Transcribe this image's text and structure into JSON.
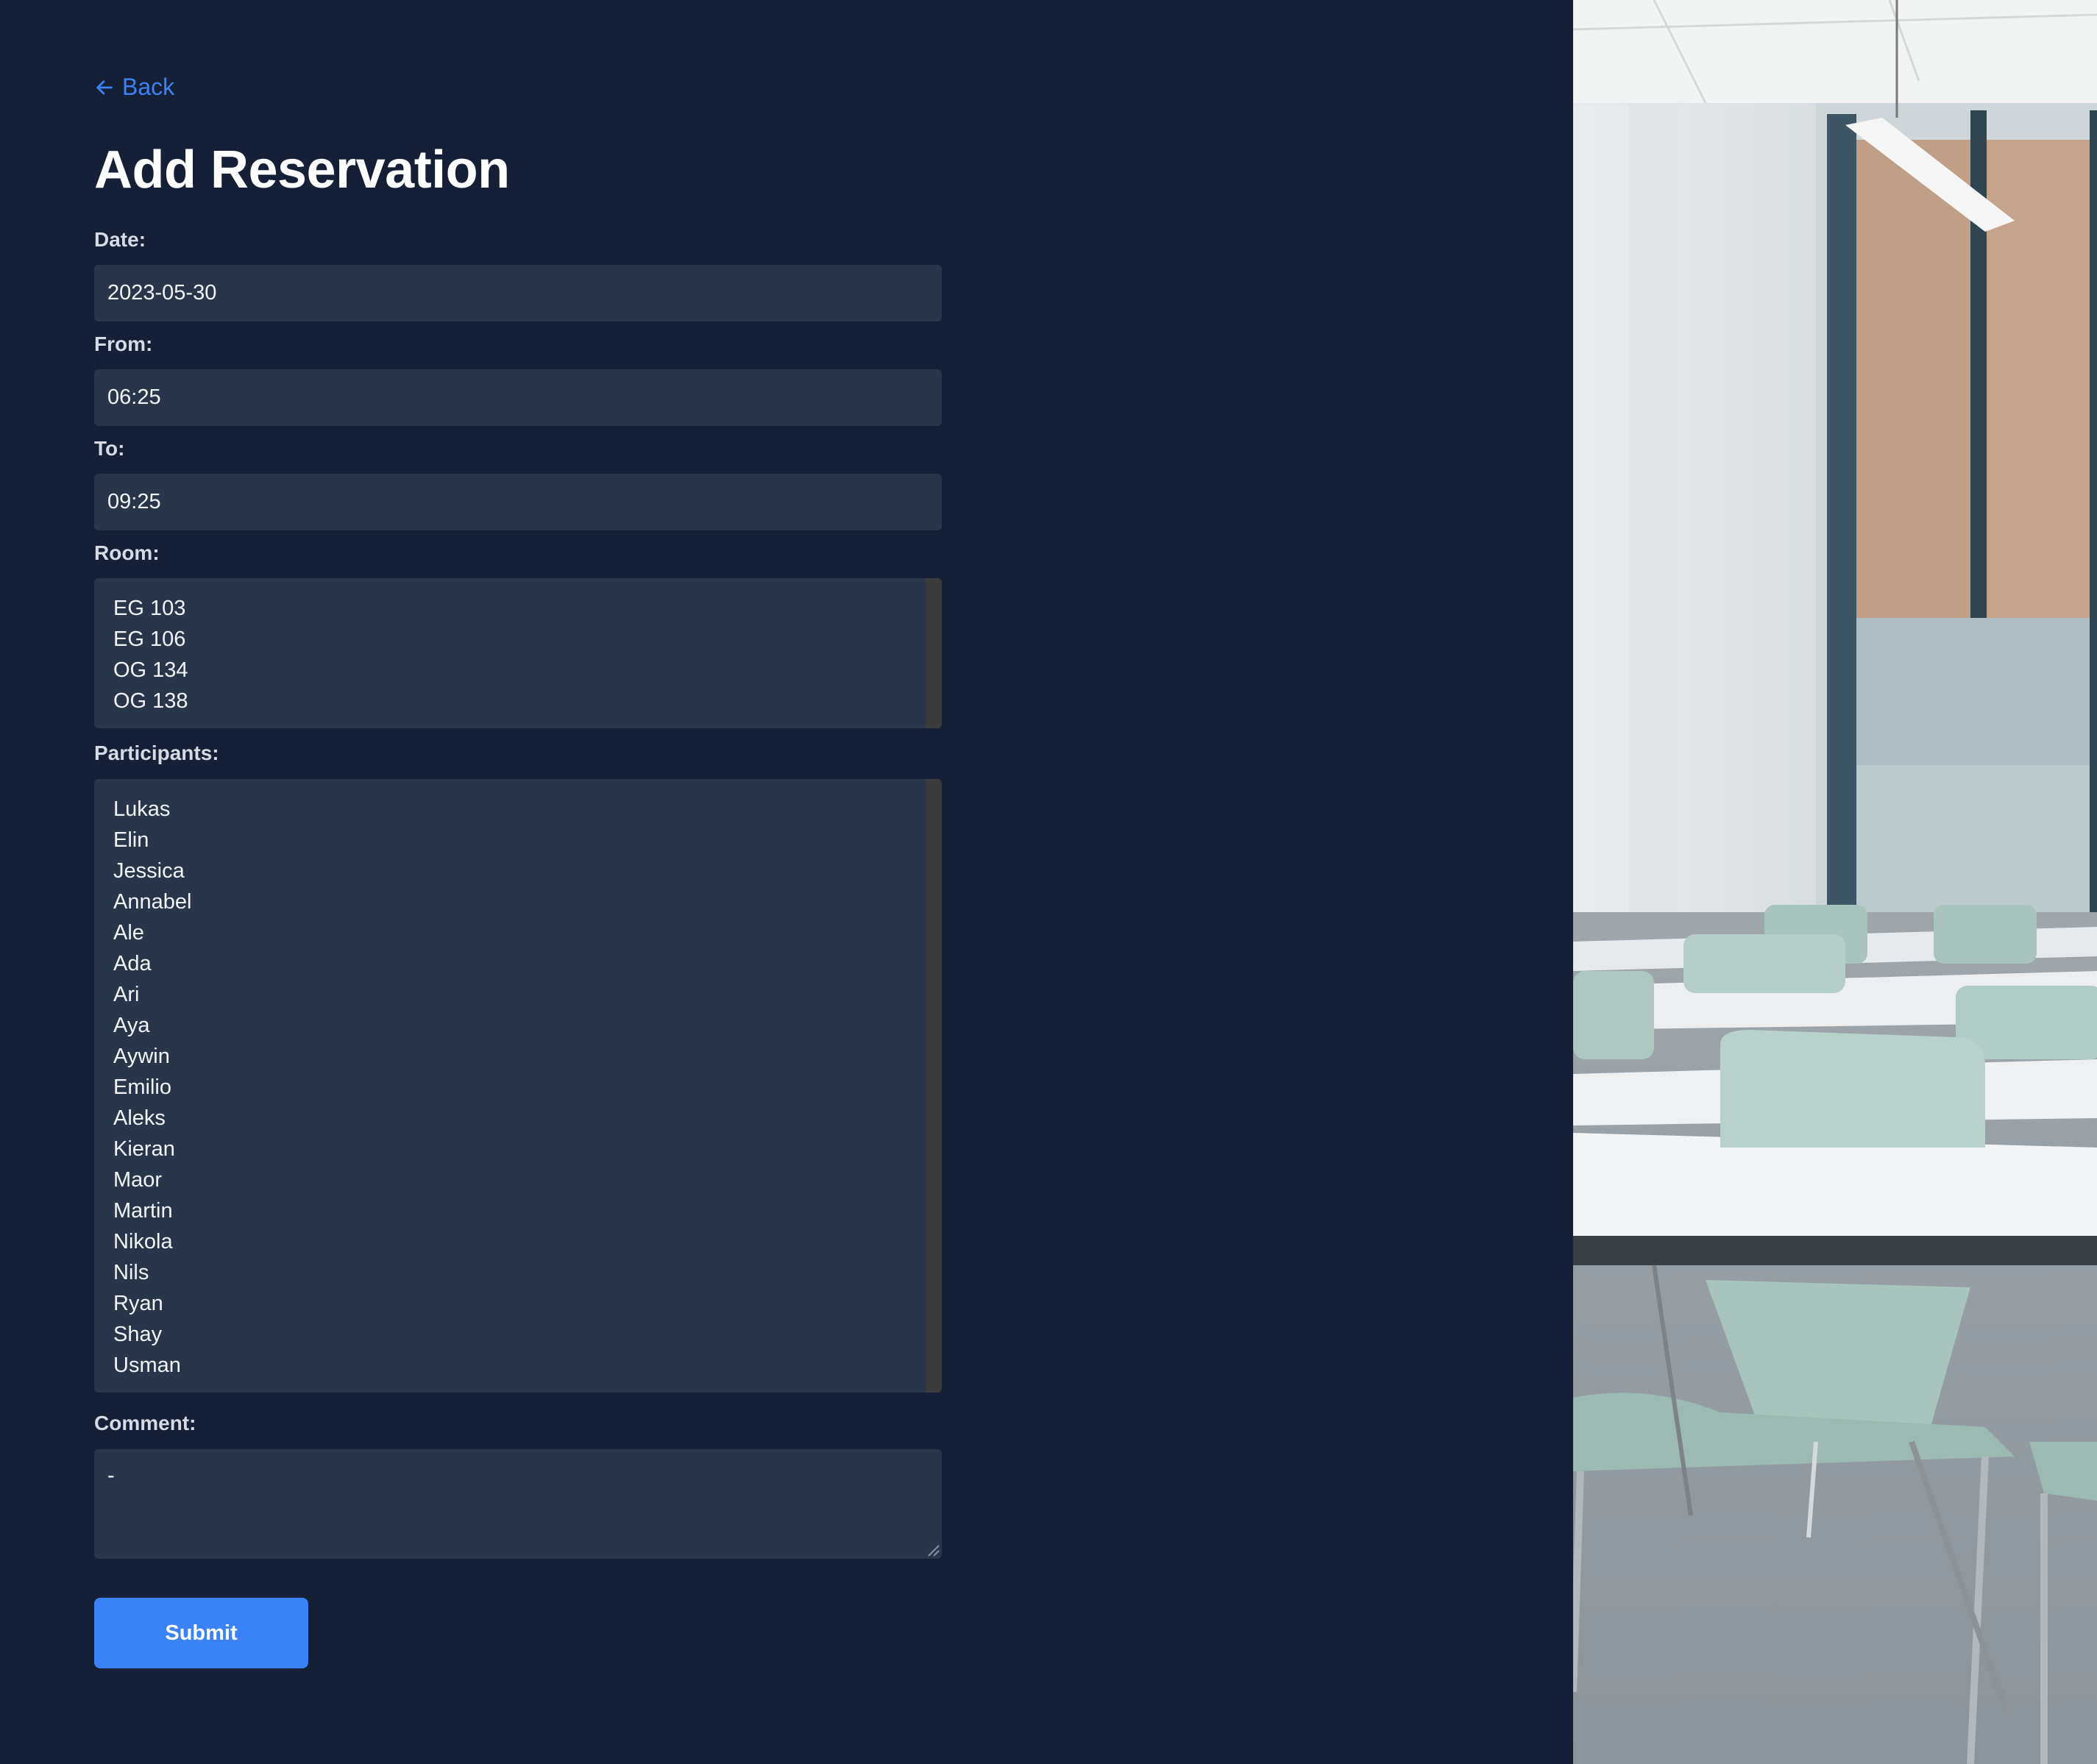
{
  "nav": {
    "back_label": "Back"
  },
  "page": {
    "title": "Add Reservation"
  },
  "form": {
    "date_label": "Date:",
    "date_value": "2023-05-30",
    "from_label": "From:",
    "from_value": "06:25",
    "to_label": "To:",
    "to_value": "09:25",
    "room_label": "Room:",
    "rooms": [
      "EG 103",
      "EG 106",
      "OG 134",
      "OG 138"
    ],
    "participants_label": "Participants:",
    "participants": [
      "Lukas",
      "Elin",
      "Jessica",
      "Annabel",
      "Ale",
      "Ada",
      "Ari",
      "Aya",
      "Aywin",
      "Emilio",
      "Aleks",
      "Kieran",
      "Maor",
      "Martin",
      "Nikola",
      "Nils",
      "Ryan",
      "Shay",
      "Usman"
    ],
    "comment_label": "Comment:",
    "comment_value": "-",
    "submit_label": "Submit"
  },
  "colors": {
    "background": "#151f35",
    "field": "#293548",
    "accent": "#3b82f6"
  },
  "icons": {
    "back": "arrow-left-icon"
  }
}
